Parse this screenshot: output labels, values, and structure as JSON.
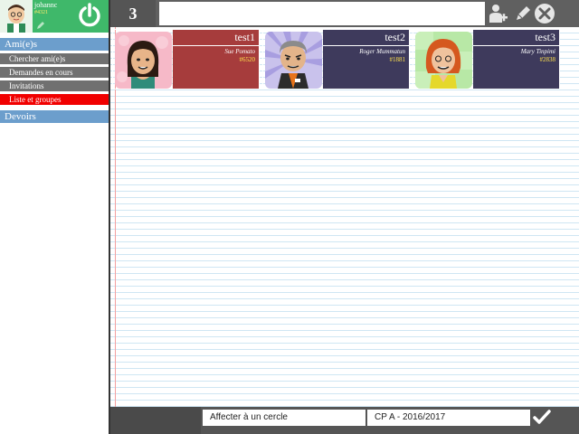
{
  "user": {
    "name": "johannc",
    "id": "#4321"
  },
  "icons": {
    "power": "power-icon",
    "edit_user": "edit-pencil-icon",
    "add_friend": "add-person-icon",
    "edit": "pencil-icon",
    "close": "close-icon",
    "confirm": "checkmark-icon"
  },
  "sidebar": {
    "section_friends": "Ami(e)s",
    "items": [
      {
        "label": "Chercher ami(e)s",
        "active": false
      },
      {
        "label": "Demandes en cours",
        "active": false
      },
      {
        "label": "Invitations",
        "active": false
      },
      {
        "label": "Liste et groupes",
        "active": true
      }
    ],
    "section_homework": "Devoirs"
  },
  "topbar": {
    "count": "3",
    "search_value": ""
  },
  "cards": [
    {
      "title": "test1",
      "name": "Sue Pomato",
      "id": "#6520",
      "color": "#a63c3c"
    },
    {
      "title": "test2",
      "name": "Roger Mummatun",
      "id": "#1881",
      "color": "#3e3a5c"
    },
    {
      "title": "test3",
      "name": "Mary Tinpimi",
      "id": "#2838",
      "color": "#3e3a5c"
    }
  ],
  "bottombar": {
    "circle_label": "Affecter à un cercle",
    "class_label": "CP A - 2016/2017"
  },
  "colors": {
    "user_box": "#3fb86a",
    "section_head": "#6c9ecc",
    "menu_item": "#707070",
    "menu_active": "#f10000"
  }
}
